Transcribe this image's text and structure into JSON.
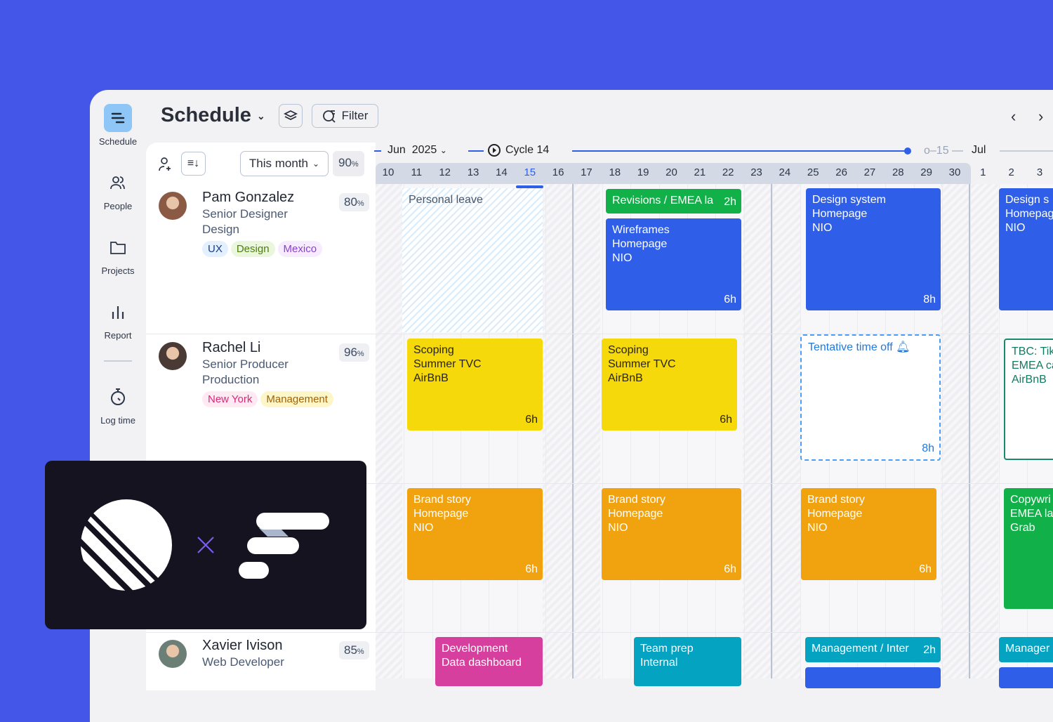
{
  "colors": {
    "background": "#4456e8",
    "blue": "#2f5fe8",
    "green": "#12b048",
    "yellow": "#f5d90a",
    "orange": "#f0a20f",
    "pink": "#d63f9e",
    "teal": "#05a3c2"
  },
  "nav": [
    {
      "label": "Schedule",
      "icon": "schedule-icon",
      "active": true
    },
    {
      "label": "People",
      "icon": "people-icon"
    },
    {
      "label": "Projects",
      "icon": "folder-icon"
    },
    {
      "label": "Report",
      "icon": "bar-chart-icon"
    },
    {
      "label": "Log time",
      "icon": "stopwatch-icon"
    }
  ],
  "header": {
    "title": "Schedule",
    "filter": "Filter"
  },
  "toolbar": {
    "period": "This month",
    "utilization": "90",
    "pct": "%"
  },
  "timeline": {
    "month": "Jun",
    "year": "2025",
    "cycle": "Cycle 14",
    "next_cycle": "15",
    "next_month": "Jul",
    "today": "15",
    "days": [
      "10",
      "11",
      "12",
      "13",
      "14",
      "15",
      "16",
      "17",
      "18",
      "19",
      "20",
      "21",
      "22",
      "23",
      "24",
      "25",
      "26",
      "27",
      "28",
      "29",
      "30",
      "1",
      "2",
      "3"
    ]
  },
  "people": [
    {
      "name": "Pam Gonzalez",
      "role": "Senior Designer",
      "dept": "Design",
      "util": "80",
      "tags": [
        "UX",
        "Design",
        "Mexico"
      ]
    },
    {
      "name": "Rachel Li",
      "role": "Senior Producer",
      "dept": "Production",
      "util": "96",
      "tags": [
        "New York",
        "Management"
      ]
    },
    {
      "name": "Xavier Ivison",
      "role": "Web Developer",
      "util": "85",
      "tags": []
    }
  ],
  "events": [
    {
      "title": "Personal leave",
      "type": "leave"
    },
    {
      "title": "Revisions / EMEA la",
      "hours": "2h",
      "color": "green"
    },
    {
      "title": "Wireframes",
      "lines": [
        "Homepage",
        "NIO"
      ],
      "hours": "6h",
      "color": "blue"
    },
    {
      "title": "Design system",
      "lines": [
        "Homepage",
        "NIO"
      ],
      "hours": "8h",
      "color": "blue"
    },
    {
      "title": "Design s",
      "lines": [
        "Homepag",
        "NIO"
      ],
      "color": "blue"
    },
    {
      "title": "Scoping",
      "lines": [
        "Summer TVC",
        "AirBnB"
      ],
      "hours": "6h",
      "color": "yellow"
    },
    {
      "title": "Scoping",
      "lines": [
        "Summer TVC",
        "AirBnB"
      ],
      "hours": "6h",
      "color": "yellow"
    },
    {
      "title": "Tentative time off",
      "hours": "8h",
      "type": "tentative"
    },
    {
      "title": "TBC: Tik",
      "lines": [
        "EMEA ca",
        "AirBnB"
      ],
      "type": "tbc"
    },
    {
      "title": "Brand story",
      "lines": [
        "Homepage",
        "NIO"
      ],
      "hours": "6h",
      "color": "orange"
    },
    {
      "title": "Brand story",
      "lines": [
        "Homepage",
        "NIO"
      ],
      "hours": "6h",
      "color": "orange"
    },
    {
      "title": "Brand story",
      "lines": [
        "Homepage",
        "NIO"
      ],
      "hours": "6h",
      "color": "orange"
    },
    {
      "title": "Copywri",
      "lines": [
        "EMEA la",
        "Grab"
      ],
      "color": "green"
    },
    {
      "title": "Development",
      "lines": [
        "Data dashboard"
      ],
      "color": "pink"
    },
    {
      "title": "Team prep",
      "lines": [
        "Internal"
      ],
      "color": "teal"
    },
    {
      "title": "Management / Inter",
      "hours": "2h",
      "color": "teal"
    },
    {
      "title": "",
      "color": "blue"
    },
    {
      "title": "Manager",
      "color": "teal"
    },
    {
      "title": "",
      "color": "blue"
    }
  ]
}
